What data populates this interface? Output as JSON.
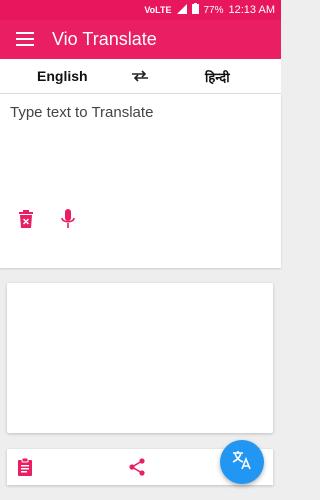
{
  "status": {
    "network": "VoLTE",
    "battery": "77%",
    "time": "12:13 AM"
  },
  "app": {
    "title": "Vio Translate",
    "accent": "#e91e63",
    "fab_color": "#2196f3"
  },
  "languages": {
    "source": "English",
    "target": "हिन्दी"
  },
  "input": {
    "placeholder": "Type text to Translate",
    "value": ""
  },
  "icons": {
    "menu": "menu-icon",
    "swap": "swap-icon",
    "clear": "delete-icon",
    "mic": "mic-icon",
    "paste": "clipboard-icon",
    "share": "share-icon",
    "translate": "translate-icon"
  }
}
